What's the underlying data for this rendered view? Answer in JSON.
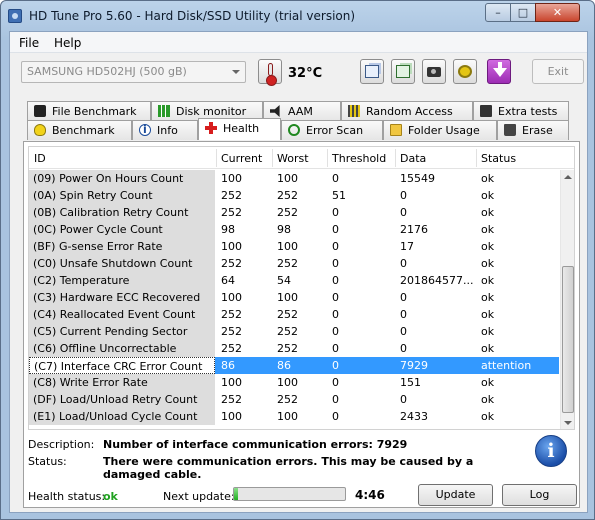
{
  "window": {
    "title": "HD Tune Pro 5.60 - Hard Disk/SSD Utility (trial version)"
  },
  "menu": {
    "file": "File",
    "help": "Help"
  },
  "toolbar": {
    "drive": "SAMSUNG HD502HJ (500 gB)",
    "temperature": "32°C",
    "exit": "Exit"
  },
  "tabs": {
    "top": [
      "File Benchmark",
      "Disk monitor",
      "AAM",
      "Random Access",
      "Extra tests"
    ],
    "bottom": [
      "Benchmark",
      "Info",
      "Health",
      "Error Scan",
      "Folder Usage",
      "Erase"
    ],
    "active": "Health"
  },
  "table": {
    "headers": [
      "ID",
      "Current",
      "Worst",
      "Threshold",
      "Data",
      "Status"
    ],
    "rows": [
      [
        "(09) Power On Hours Count",
        "100",
        "100",
        "0",
        "15549",
        "ok"
      ],
      [
        "(0A) Spin Retry Count",
        "252",
        "252",
        "51",
        "0",
        "ok"
      ],
      [
        "(0B) Calibration Retry Count",
        "252",
        "252",
        "0",
        "0",
        "ok"
      ],
      [
        "(0C) Power Cycle Count",
        "98",
        "98",
        "0",
        "2176",
        "ok"
      ],
      [
        "(BF) G-sense Error Rate",
        "100",
        "100",
        "0",
        "17",
        "ok"
      ],
      [
        "(C0) Unsafe Shutdown Count",
        "252",
        "252",
        "0",
        "0",
        "ok"
      ],
      [
        "(C2) Temperature",
        "64",
        "54",
        "0",
        "201864577...",
        "ok"
      ],
      [
        "(C3) Hardware ECC Recovered",
        "100",
        "100",
        "0",
        "0",
        "ok"
      ],
      [
        "(C4) Reallocated Event Count",
        "252",
        "252",
        "0",
        "0",
        "ok"
      ],
      [
        "(C5) Current Pending Sector",
        "252",
        "252",
        "0",
        "0",
        "ok"
      ],
      [
        "(C6) Offline Uncorrectable",
        "252",
        "252",
        "0",
        "0",
        "ok"
      ],
      [
        "(C7) Interface CRC Error Count",
        "86",
        "86",
        "0",
        "7929",
        "attention"
      ],
      [
        "(C8) Write Error Rate",
        "100",
        "100",
        "0",
        "151",
        "ok"
      ],
      [
        "(DF) Load/Unload Retry Count",
        "252",
        "252",
        "0",
        "0",
        "ok"
      ],
      [
        "(E1) Load/Unload Cycle Count",
        "100",
        "100",
        "0",
        "2433",
        "ok"
      ]
    ],
    "selected_row": 11
  },
  "details": {
    "description_label": "Description:",
    "description": "Number of interface communication errors: 7929",
    "status_label": "Status:",
    "status": "There were communication errors. This may be caused by a damaged cable."
  },
  "footer": {
    "health_label": "Health status:",
    "health_value": "ok",
    "next_update_label": "Next update:",
    "progress_fraction": 0.04,
    "timer": "4:46",
    "update": "Update",
    "log": "Log"
  },
  "colors": {
    "selection": "#3399ff",
    "health_ok": "#1fa11f"
  },
  "icons": [
    "thermometer-icon",
    "copy-text-icon",
    "copy-screenshot-icon",
    "camera-icon",
    "options-icon",
    "exit-arrow-icon",
    "info-icon"
  ]
}
